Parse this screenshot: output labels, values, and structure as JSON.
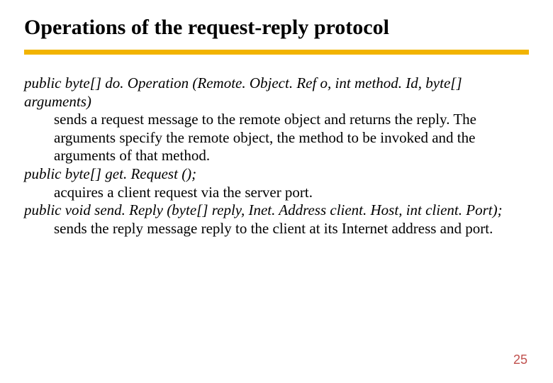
{
  "title": "Operations of the request-reply protocol",
  "ops": [
    {
      "sig": "public byte[] do. Operation (Remote. Object. Ref o, int method. Id, byte[] arguments)",
      "desc": "sends a request message to the remote object and returns the reply. The arguments specify the remote object, the method to be invoked and the arguments of that method."
    },
    {
      "sig": "public byte[] get. Request ();",
      "desc": "acquires a client request via the server port."
    },
    {
      "sig": "public void send. Reply (byte[] reply, Inet. Address client. Host, int client. Port);",
      "desc": "sends the reply message reply to the client at its Internet address and port."
    }
  ],
  "page": "25"
}
